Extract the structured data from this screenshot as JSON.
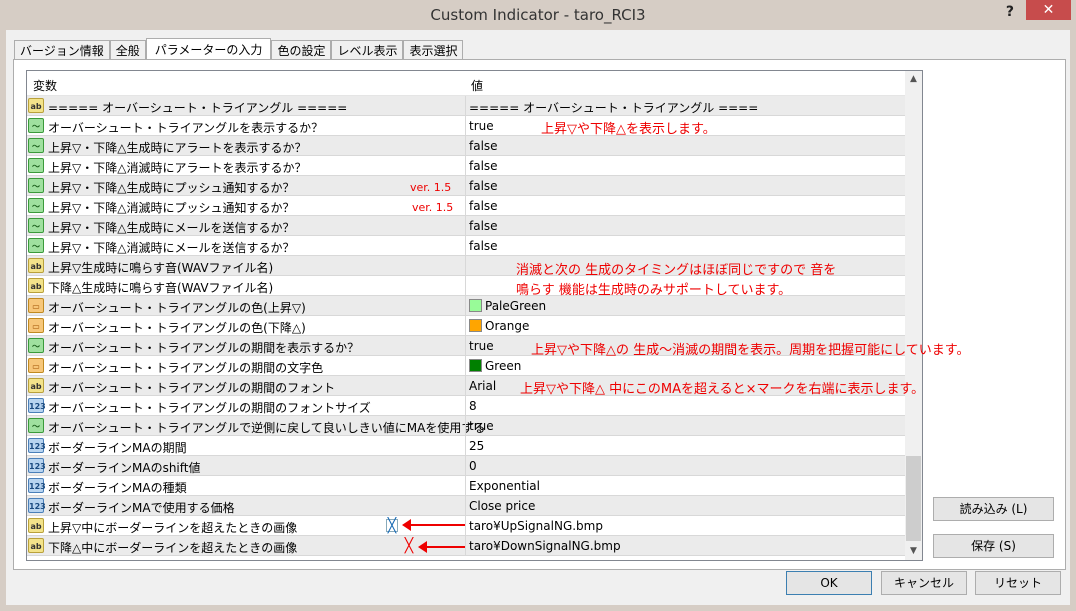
{
  "window": {
    "title": "Custom Indicator - taro_RCI3",
    "help": "?",
    "close": "✕"
  },
  "tabs": [
    "バージョン情報",
    "全般",
    "パラメーターの入力",
    "色の設定",
    "レベル表示",
    "表示選択"
  ],
  "active_tab": 2,
  "grid": {
    "col_name": "変数",
    "col_value": "値",
    "rows": [
      {
        "type": "ab",
        "name": "===== オーバーシュート・トライアングル =====",
        "value": "===== オーバーシュート・トライアングル ===="
      },
      {
        "type": "bool",
        "name": "オーバーシュート・トライアングルを表示するか？",
        "value": "true"
      },
      {
        "type": "bool",
        "name": "上昇▽・下降△生成時にアラートを表示するか？",
        "value": "false"
      },
      {
        "type": "bool",
        "name": "上昇▽・下降△消滅時にアラートを表示するか？",
        "value": "false"
      },
      {
        "type": "bool",
        "name": "上昇▽・下降△生成時にプッシュ通知するか？",
        "value": "false"
      },
      {
        "type": "bool",
        "name": "上昇▽・下降△消滅時にプッシュ通知するか？",
        "value": "false"
      },
      {
        "type": "bool",
        "name": "上昇▽・下降△生成時にメールを送信するか？",
        "value": "false"
      },
      {
        "type": "bool",
        "name": "上昇▽・下降△消滅時にメールを送信するか？",
        "value": "false"
      },
      {
        "type": "ab",
        "name": "上昇▽生成時に鳴らす音(WAVファイル名)",
        "value": ""
      },
      {
        "type": "ab",
        "name": "下降△生成時に鳴らす音(WAVファイル名)",
        "value": ""
      },
      {
        "type": "col",
        "name": "オーバーシュート・トライアングルの色(上昇▽)",
        "value": "PaleGreen",
        "swatch": "#98fb98"
      },
      {
        "type": "col",
        "name": "オーバーシュート・トライアングルの色(下降△)",
        "value": "Orange",
        "swatch": "#ffa500"
      },
      {
        "type": "bool",
        "name": "オーバーシュート・トライアングルの期間を表示するか？",
        "value": "true"
      },
      {
        "type": "col",
        "name": "オーバーシュート・トライアングルの期間の文字色",
        "value": "Green",
        "swatch": "#008000"
      },
      {
        "type": "ab",
        "name": "オーバーシュート・トライアングルの期間のフォント",
        "value": "Arial"
      },
      {
        "type": "num",
        "name": "オーバーシュート・トライアングルの期間のフォントサイズ",
        "value": "8"
      },
      {
        "type": "bool",
        "name": "オーバーシュート・トライアングルで逆側に戻して良いしきい値にMAを使用する",
        "value": "true"
      },
      {
        "type": "num",
        "name": "ボーダーラインMAの期間",
        "value": "25"
      },
      {
        "type": "num",
        "name": "ボーダーラインMAのshift値",
        "value": "0"
      },
      {
        "type": "num",
        "name": "ボーダーラインMAの種類",
        "value": "Exponential"
      },
      {
        "type": "num",
        "name": "ボーダーラインMAで使用する価格",
        "value": "Close price"
      },
      {
        "type": "ab",
        "name": "上昇▽中にボーダーラインを超えたときの画像",
        "value": "taro¥UpSignalNG.bmp"
      },
      {
        "type": "ab",
        "name": "下降△中にボーダーラインを超えたときの画像",
        "value": "taro¥DownSignalNG.bmp"
      }
    ]
  },
  "icon_labels": {
    "ab": "ab",
    "bool": "〜",
    "num": "123",
    "col": "▭"
  },
  "annotations": {
    "note1": "上昇▽や下降△を表示します。",
    "note2a": "消滅と次の 生成のタイミングはほぼ同じですので 音を",
    "note2b": "鳴らす 機能は生成時のみサポートしています。",
    "note3": "上昇▽や下降△の 生成～消滅の期間を表示。周期を把握可能にしています。",
    "note4": "上昇▽や下降△ 中にこのMAを超えると×マークを右端に表示します。",
    "ver1": "ver. 1.5",
    "ver2": "ver. 1.5",
    "x_blue": "╳",
    "x_red": "╳"
  },
  "buttons": {
    "load": "読み込み (L)",
    "save": "保存 (S)",
    "ok": "OK",
    "cancel": "キャンセル",
    "reset": "リセット"
  },
  "colors": {
    "annotation": "#e00000",
    "close": "#c74c4c"
  }
}
